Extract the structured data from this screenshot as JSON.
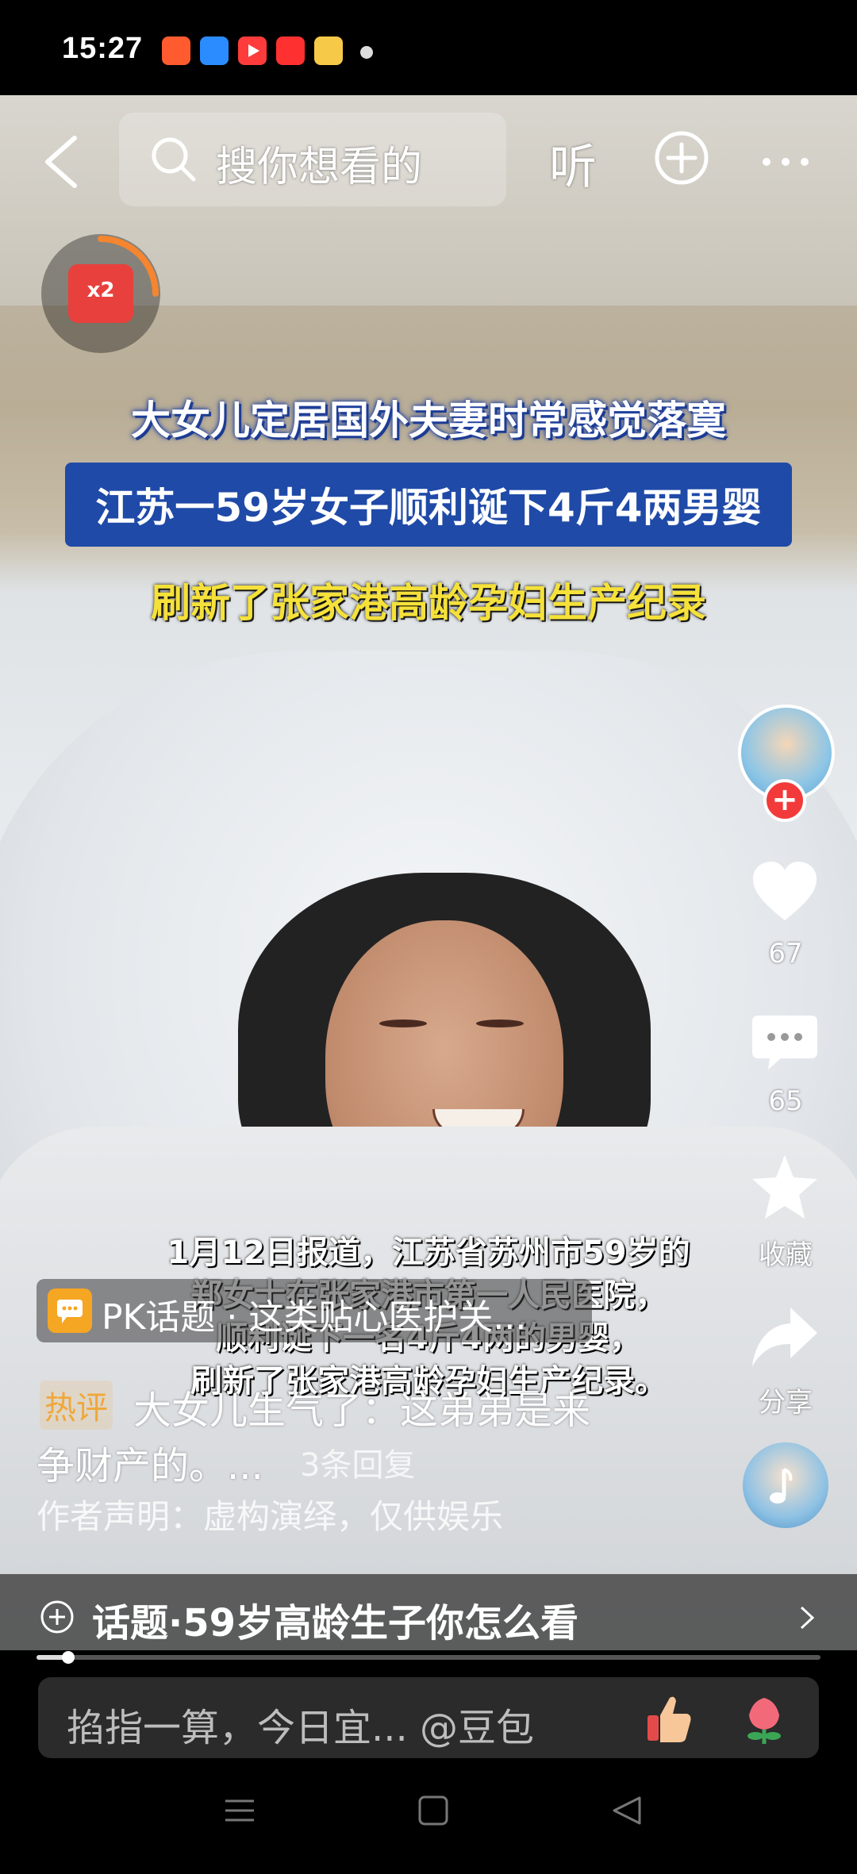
{
  "status_bar": {
    "time": "15:27",
    "app_icons": [
      {
        "name": "taobao-app-icon",
        "color": "#ff5b2e"
      },
      {
        "name": "blue-app-icon",
        "color": "#2b8cff"
      },
      {
        "name": "video-app-icon",
        "color": "#ff3b3b"
      },
      {
        "name": "toutiao-app-icon",
        "color": "#ff3030"
      },
      {
        "name": "photo-app-icon",
        "color": "#f7c948"
      }
    ]
  },
  "top_nav": {
    "search_placeholder": "搜你想看的",
    "listen_label": "听"
  },
  "red_packet": {
    "label": "x2",
    "color": "#e8413d",
    "progress": 0.3
  },
  "video_captions": {
    "line1": "大女儿定居国外夫妻时常感觉落寞",
    "line2": "江苏一59岁女子顺利诞下4斤4两男婴",
    "line3": "刷新了张家港高龄孕妇生产纪录"
  },
  "video_subtitles": [
    "1月12日报道，江苏省苏州市59岁的",
    "郑女士在张家港市第一人民医院，",
    "顺利诞下一名4斤4两的男婴，",
    "刷新了张家港高龄孕妇生产纪录。"
  ],
  "actions": {
    "like_count": "67",
    "comment_count": "65",
    "favorite_label": "收藏",
    "share_label": "分享"
  },
  "pk_topic": {
    "text": "PK话题 · 这类贴心医护关..."
  },
  "hot_comment": {
    "tag": "热评",
    "line1": "大女儿生气了：这弟弟是来",
    "line2": "争财产的。...",
    "replies": "3条回复"
  },
  "disclaimer": "作者声明：虚构演绎，仅供娱乐",
  "topic_bar": {
    "text": "话题·59岁高龄生子你怎么看"
  },
  "playback": {
    "progress": 0.04
  },
  "comment_input": {
    "placeholder": "掐指一算，今日宜... @豆包"
  },
  "colors": {
    "accent_red": "#f23a3a",
    "caption_blue": "#1f4aa8",
    "caption_yellow": "#f5e13a"
  }
}
